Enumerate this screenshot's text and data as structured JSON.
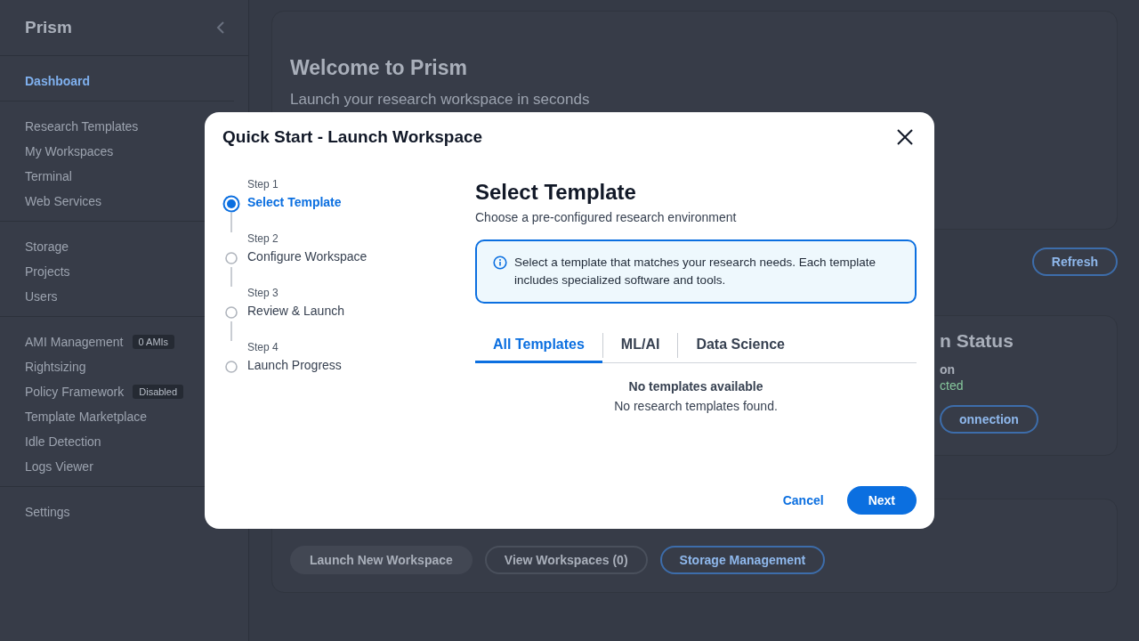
{
  "sidebar": {
    "title": "Prism",
    "groups": [
      [
        {
          "label": "Dashboard",
          "selected": true
        }
      ],
      [
        {
          "label": "Research Templates",
          "selected": false
        },
        {
          "label": "My Workspaces",
          "selected": false
        },
        {
          "label": "Terminal",
          "selected": false
        },
        {
          "label": "Web Services",
          "selected": false
        }
      ],
      [
        {
          "label": "Storage",
          "selected": false
        },
        {
          "label": "Projects",
          "selected": false
        },
        {
          "label": "Users",
          "selected": false
        }
      ],
      [
        {
          "label": "AMI Management",
          "selected": false,
          "badge": "0 AMIs"
        },
        {
          "label": "Rightsizing",
          "selected": false
        },
        {
          "label": "Policy Framework",
          "selected": false,
          "badge": "Disabled"
        },
        {
          "label": "Template Marketplace",
          "selected": false
        },
        {
          "label": "Idle Detection",
          "selected": false
        },
        {
          "label": "Logs Viewer",
          "selected": false
        }
      ],
      [
        {
          "label": "Settings",
          "selected": false
        }
      ]
    ]
  },
  "welcome": {
    "title": "Welcome to Prism",
    "subtitle": "Launch your research workspace in seconds"
  },
  "refresh_button": "Refresh",
  "status_card": {
    "title": "n Status",
    "label": "on",
    "value": "cted",
    "button": "onnection"
  },
  "quick_actions": {
    "buttons": [
      {
        "label": "Launch New Workspace",
        "kind": "filled"
      },
      {
        "label": "View Workspaces (0)",
        "kind": "outline"
      },
      {
        "label": "Storage Management",
        "kind": "primary"
      }
    ]
  },
  "modal": {
    "title": "Quick Start - Launch Workspace",
    "steps": [
      {
        "step": "Step 1",
        "label": "Select Template",
        "selected": true
      },
      {
        "step": "Step 2",
        "label": "Configure Workspace",
        "selected": false
      },
      {
        "step": "Step 3",
        "label": "Review & Launch",
        "selected": false
      },
      {
        "step": "Step 4",
        "label": "Launch Progress",
        "selected": false
      }
    ],
    "heading": "Select Template",
    "description": "Choose a pre-configured research environment",
    "info": "Select a template that matches your research needs. Each template includes specialized software and tools.",
    "tabs": [
      {
        "label": "All Templates",
        "selected": true
      },
      {
        "label": "ML/AI",
        "selected": false
      },
      {
        "label": "Data Science",
        "selected": false
      }
    ],
    "empty_title": "No templates available",
    "empty_text": "No research templates found.",
    "cancel": "Cancel",
    "next": "Next"
  }
}
